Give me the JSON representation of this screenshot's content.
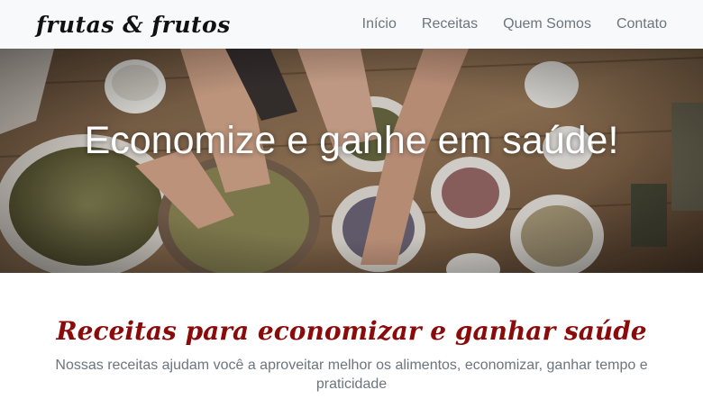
{
  "navbar": {
    "brand": "frutas & frutos",
    "links": [
      "Início",
      "Receitas",
      "Quem Somos",
      "Contato"
    ]
  },
  "hero": {
    "title": "Economize e ganhe em saúde!"
  },
  "section": {
    "title": "Receitas para economizar e ganhar saúde",
    "subtitle": "Nossas receitas ajudam você a aproveitar melhor os alimentos, economizar, ganhar tempo e praticidade"
  },
  "colors": {
    "navbar_bg": "#f8f9fa",
    "accent": "#8b0a0a",
    "muted_text": "#6c757d"
  }
}
